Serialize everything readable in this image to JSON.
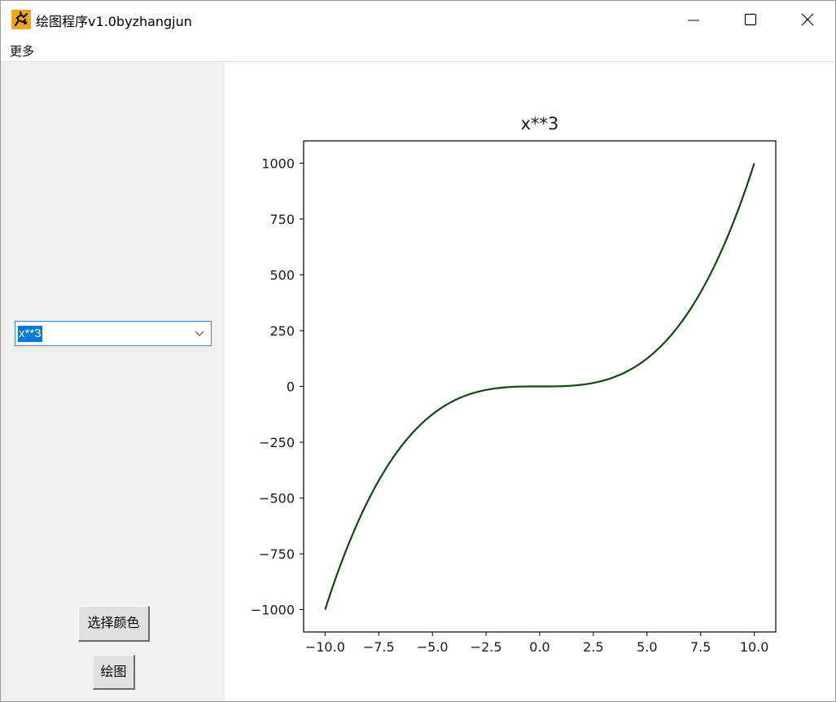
{
  "window": {
    "title": "绘图程序v1.0byzhangjun"
  },
  "menu": {
    "items": [
      "更多"
    ]
  },
  "controls": {
    "function_select": {
      "value": "x**3"
    },
    "color_button": "选择颜色",
    "draw_button": "绘图"
  },
  "colors": {
    "curve": "#0f4a0f",
    "selection": "#0078d7"
  },
  "chart_data": {
    "type": "line",
    "title": "x**3",
    "xlabel": "",
    "ylabel": "",
    "xlim": [
      -11,
      11
    ],
    "ylim": [
      -1100,
      1100
    ],
    "x_ticks": [
      -10,
      -7.5,
      -5,
      -2.5,
      0,
      2.5,
      5,
      7.5,
      10
    ],
    "x_tick_labels": [
      "−10.0",
      "−7.5",
      "−5.0",
      "−2.5",
      "0.0",
      "2.5",
      "5.0",
      "7.5",
      "10.0"
    ],
    "y_ticks": [
      1000,
      750,
      500,
      250,
      0,
      -250,
      -500,
      -750,
      -1000
    ],
    "y_tick_labels": [
      "1000",
      "750",
      "500",
      "250",
      "0",
      "−250",
      "−500",
      "−750",
      "−1000"
    ],
    "grid": false,
    "series": [
      {
        "color": "#0f4a0f",
        "x": [
          -10,
          -9,
          -8,
          -7,
          -6,
          -5,
          -4,
          -3,
          -2,
          -1,
          0,
          1,
          2,
          3,
          4,
          5,
          6,
          7,
          8,
          9,
          10
        ],
        "y": [
          -1000,
          -729,
          -512,
          -343,
          -216,
          -125,
          -64,
          -27,
          -8,
          -1,
          0,
          1,
          8,
          27,
          64,
          125,
          216,
          343,
          512,
          729,
          1000
        ]
      }
    ]
  }
}
